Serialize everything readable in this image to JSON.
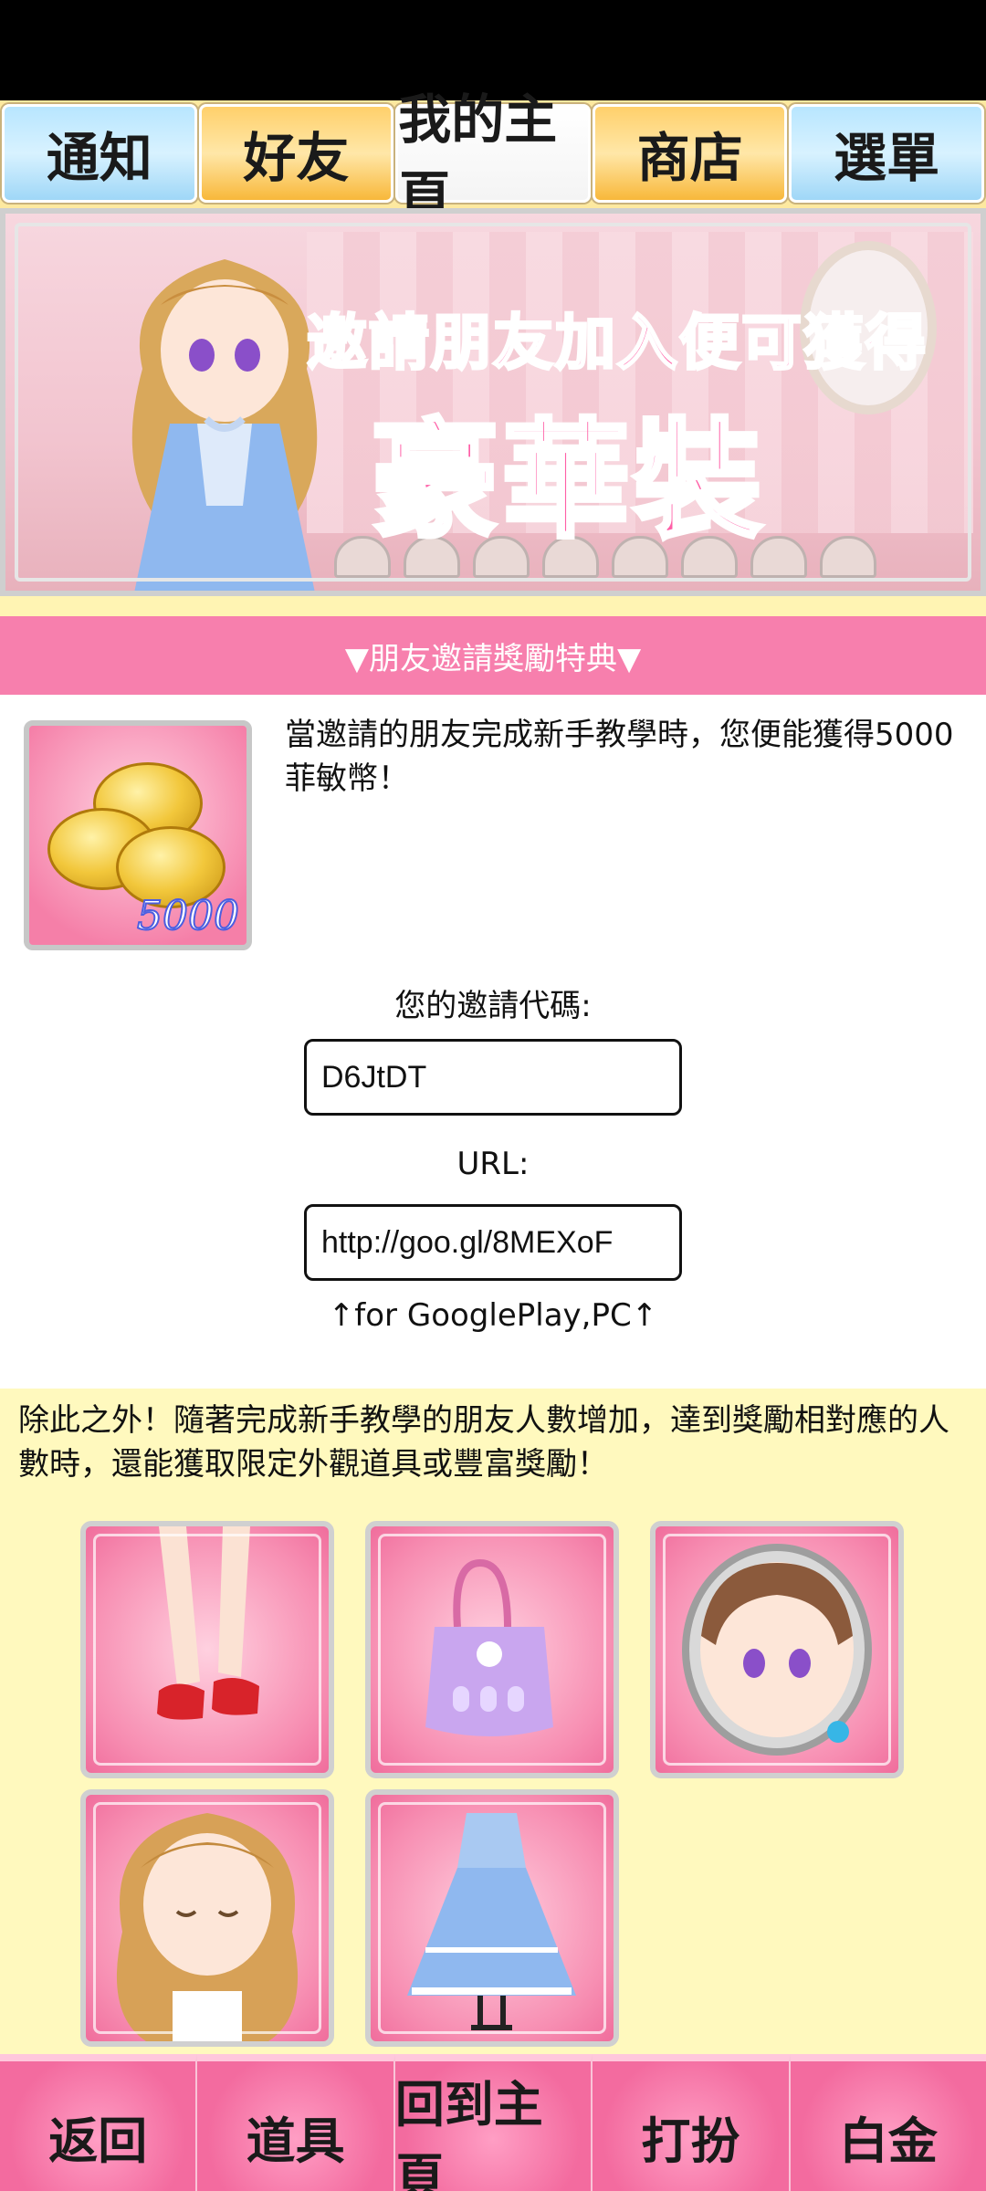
{
  "topnav": {
    "tabs": [
      "通知",
      "好友",
      "我的主頁",
      "商店",
      "選單"
    ]
  },
  "banner": {
    "line1": "邀請朋友加入便可獲得",
    "line2": "豪華裝飾！"
  },
  "section_header": "▼朋友邀請獎勵特典▼",
  "reward": {
    "amount_badge": "5000",
    "description": "當邀請的朋友完成新手教學時，您便能獲得5000菲敏幣！"
  },
  "invite": {
    "code_label": "您的邀請代碼:",
    "code_value": "D6JtDT",
    "url_label": "URL:",
    "url_value": "http://goo.gl/8MEXoF",
    "note": "↑for GooglePlay,PC↑"
  },
  "info_text": "除此之外！隨著完成新手教學的朋友人數增加，達到獎勵相對應的人數時，還能獲取限定外觀道具或豐富獎勵！",
  "bottomnav": {
    "tabs": [
      "返回",
      "道具",
      "回到主頁",
      "打扮",
      "白金"
    ]
  },
  "colors": {
    "pink_header": "#f77fad",
    "cream_bg": "#fff9be",
    "bottom_pink": "#f36b9f"
  }
}
